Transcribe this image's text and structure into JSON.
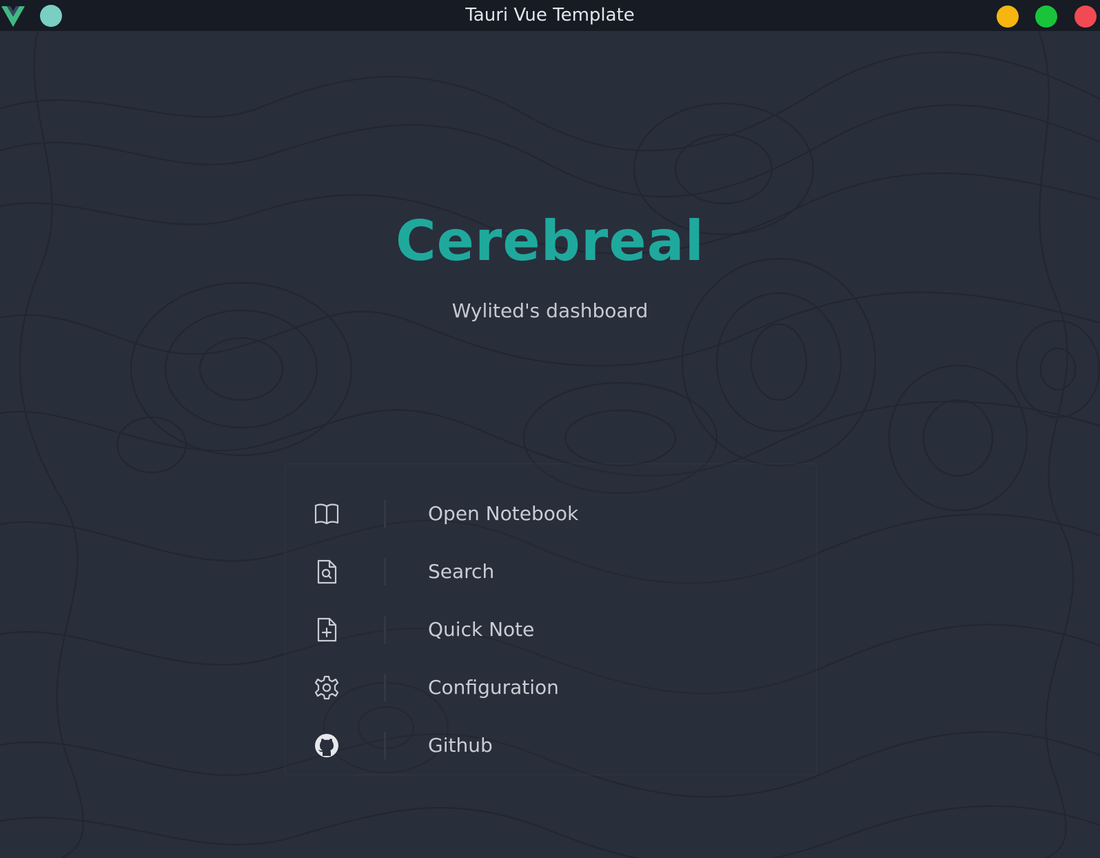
{
  "window": {
    "title": "Tauri Vue Template",
    "controls": {
      "minimize_color": "#f6b50f",
      "maximize_color": "#19c43b",
      "close_color": "#f24a53"
    },
    "menu_dot_color": "#79cfc2",
    "logo_icon": "vue-logo-icon"
  },
  "theme": {
    "accent": "#1fa99d",
    "background": "#292e3b",
    "titlebar": "#161b24",
    "text": "#c9cdd4"
  },
  "dashboard": {
    "title": "Cerebreal",
    "subtitle": "Wylited's dashboard"
  },
  "menu": {
    "items": [
      {
        "label": "Open Notebook",
        "icon": "book-open-icon"
      },
      {
        "label": "Search",
        "icon": "file-search-icon"
      },
      {
        "label": "Quick Note",
        "icon": "file-plus-icon"
      },
      {
        "label": "Configuration",
        "icon": "gear-icon"
      },
      {
        "label": "Github",
        "icon": "github-icon"
      }
    ]
  }
}
